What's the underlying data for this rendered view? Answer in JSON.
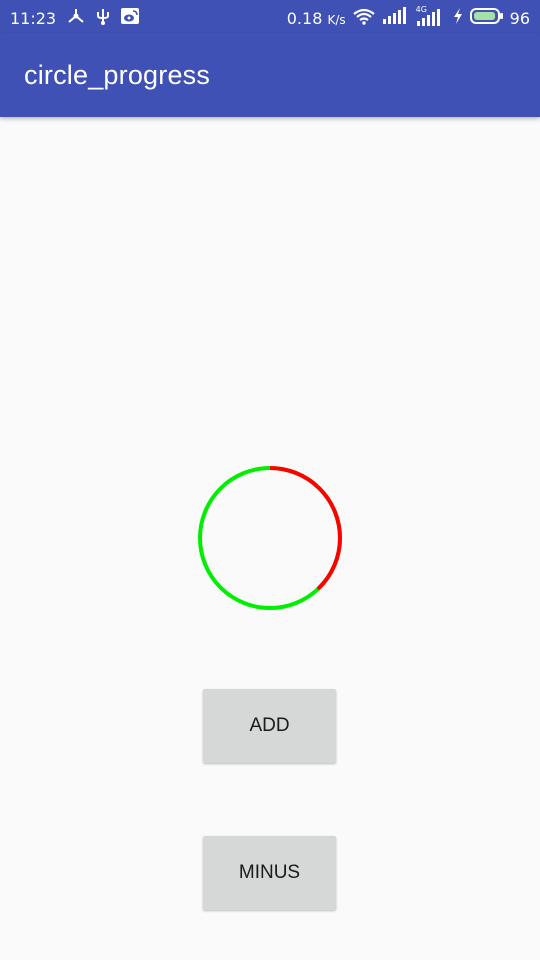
{
  "status_bar": {
    "time": "11:23",
    "left_icons": [
      "share-icon",
      "usb-icon",
      "weibo-icon"
    ],
    "net_speed_value": "0.18",
    "net_speed_unit": "K/s",
    "network_type": "4G",
    "battery_level": "96",
    "battery_fraction": 0.96
  },
  "app_bar": {
    "title": "circle_progress"
  },
  "circle_progress": {
    "progress_fraction": 0.38,
    "progress_color": "#ff0000",
    "track_color": "#00ee00"
  },
  "buttons": {
    "add_label": "ADD",
    "minus_label": "MINUS"
  },
  "colors": {
    "primary": "#3f51b5",
    "background": "#fafafa",
    "button": "#d6d7d7"
  }
}
